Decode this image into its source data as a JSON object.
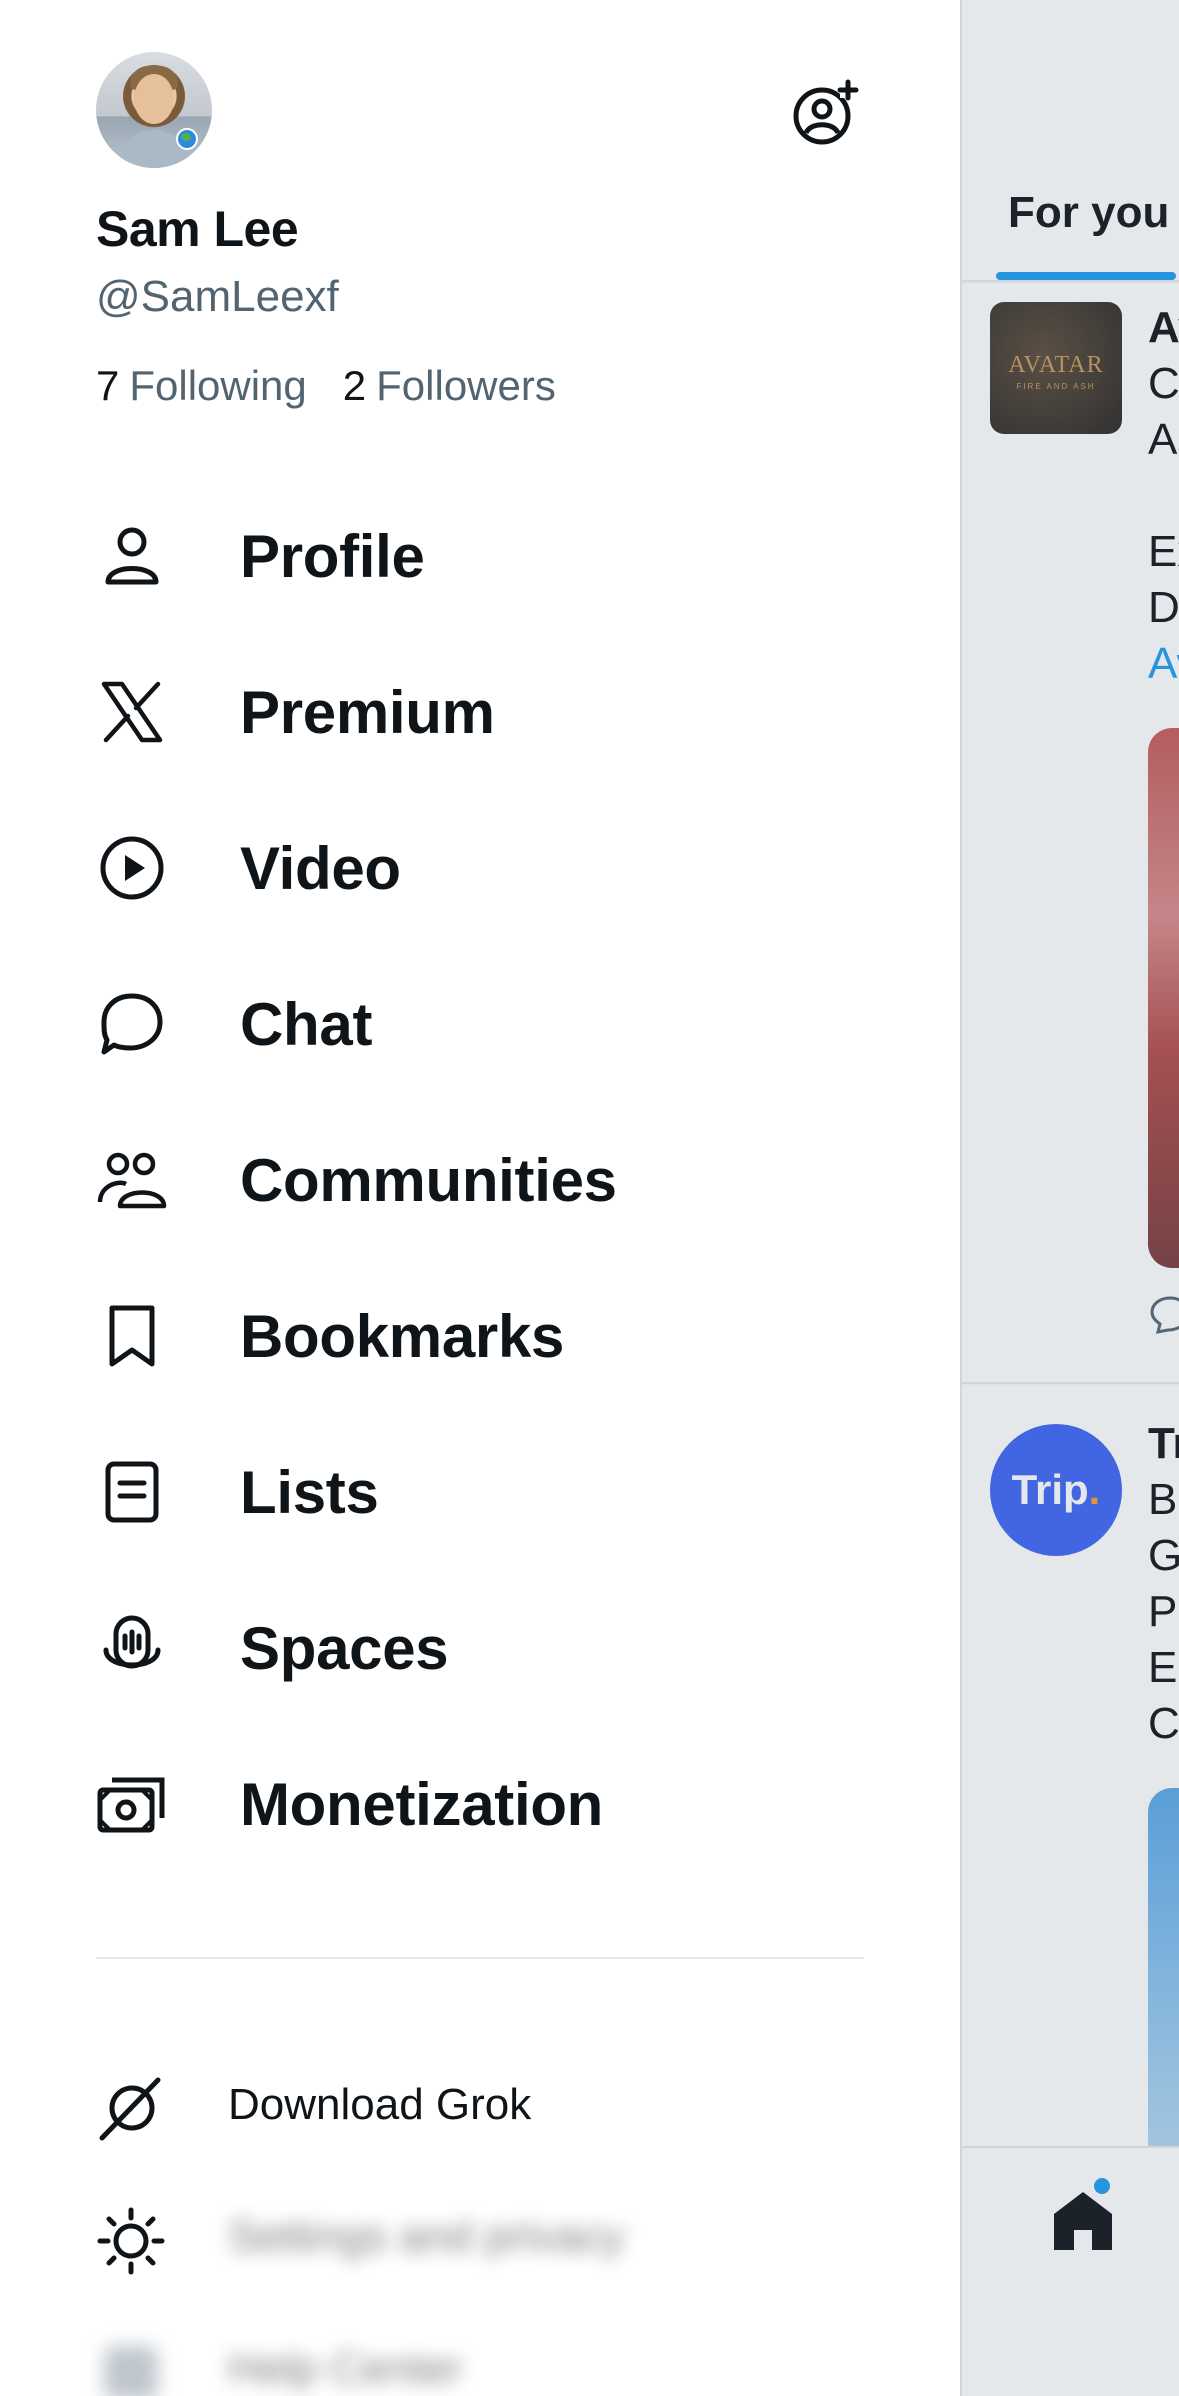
{
  "drawer": {
    "user": {
      "name": "Sam Lee",
      "handle": "@SamLeexf",
      "following_count": "7",
      "following_label": "Following",
      "followers_count": "2",
      "followers_label": "Followers",
      "avatar_icon": "profile-photo"
    },
    "add_account_icon": "add-account-icon",
    "menu": [
      {
        "label": "Profile",
        "icon": "person-icon"
      },
      {
        "label": "Premium",
        "icon": "x-logo-icon"
      },
      {
        "label": "Video",
        "icon": "play-circle-icon"
      },
      {
        "label": "Chat",
        "icon": "chat-bubble-icon"
      },
      {
        "label": "Communities",
        "icon": "communities-icon"
      },
      {
        "label": "Bookmarks",
        "icon": "bookmark-icon"
      },
      {
        "label": "Lists",
        "icon": "list-icon"
      },
      {
        "label": "Spaces",
        "icon": "microphone-icon"
      },
      {
        "label": "Monetization",
        "icon": "money-icon"
      }
    ],
    "secondary": [
      {
        "label": "Download Grok",
        "icon": "grok-icon"
      },
      {
        "label": "Settings and privacy",
        "icon": "sun-icon"
      },
      {
        "label": "Help Center",
        "icon": "help-icon"
      }
    ]
  },
  "timeline": {
    "tab": "For you",
    "post1": {
      "lines": [
        "Av",
        "C",
        "As",
        "",
        "Ex",
        "D"
      ],
      "link_line": "Av",
      "thumb_title": "AVATAR",
      "thumb_subtitle": "FIRE AND ASH"
    },
    "post2": {
      "logo_text": "Trip",
      "logo_dot": ".",
      "lines": [
        "Tr",
        "B(",
        "G",
        "Pl",
        "Er",
        "C"
      ]
    }
  },
  "colors": {
    "accent": "#1d9bf0",
    "text_primary": "#0f1419",
    "text_secondary": "#536471",
    "divider": "#e6e9ec"
  }
}
